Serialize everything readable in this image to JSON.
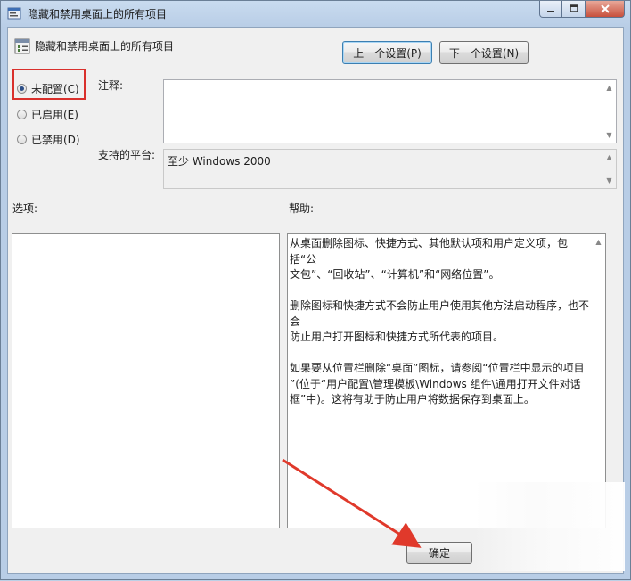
{
  "window": {
    "title": "隐藏和禁用桌面上的所有项目"
  },
  "header": {
    "title": "隐藏和禁用桌面上的所有项目",
    "prev_button": "上一个设置(P)",
    "next_button": "下一个设置(N)"
  },
  "state": {
    "options": [
      {
        "label": "未配置(C)",
        "selected": true
      },
      {
        "label": "已启用(E)",
        "selected": false
      },
      {
        "label": "已禁用(D)",
        "selected": false
      }
    ]
  },
  "comment": {
    "label": "注释:",
    "value": ""
  },
  "platform": {
    "label": "支持的平台:",
    "value": "至少 Windows 2000"
  },
  "options_section": {
    "label": "选项:"
  },
  "help_section": {
    "label": "帮助:",
    "text": "从桌面删除图标、快捷方式、其他默认项和用户定义项，包括“公\n文包”、“回收站”、“计算机”和“网络位置”。\n\n删除图标和快捷方式不会防止用户使用其他方法启动程序，也不会\n防止用户打开图标和快捷方式所代表的项目。\n\n如果要从位置栏删除“桌面”图标，请参阅“位置栏中显示的项目\n”(位于“用户配置\\管理模板\\Windows 组件\\通用打开文件对话\n框”中)。这将有助于防止用户将数据保存到桌面上。"
  },
  "footer": {
    "ok_button": "确定"
  },
  "colors": {
    "highlight": "#d9302c",
    "arrow": "#e0392b"
  }
}
